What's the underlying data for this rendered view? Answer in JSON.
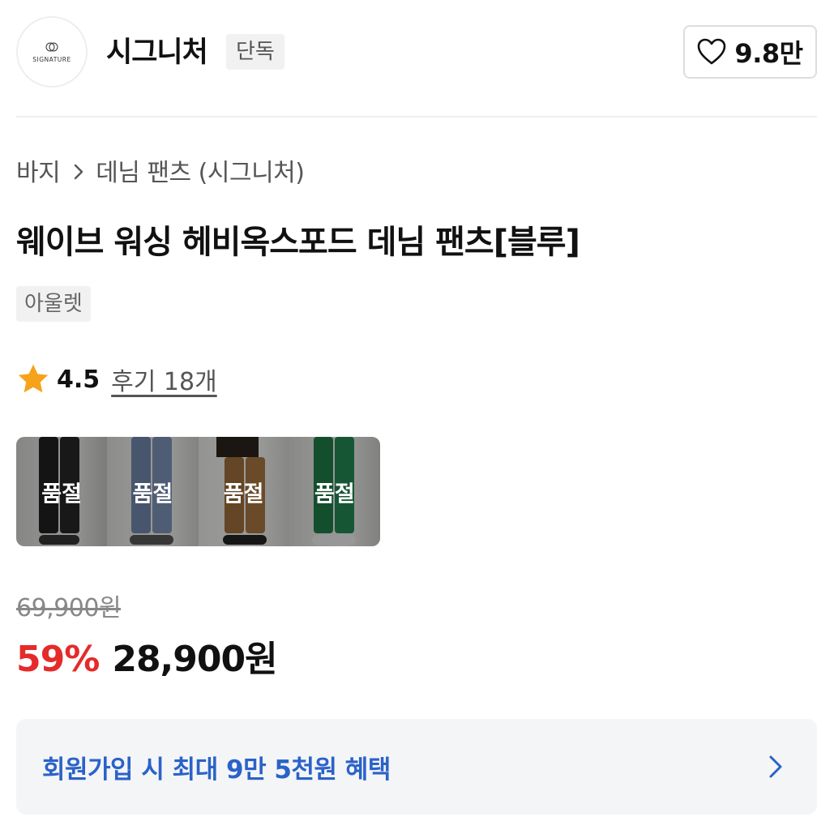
{
  "header": {
    "logo_text": "SIGNATURE",
    "brand_name": "시그니처",
    "exclusive_badge": "단독",
    "like_count": "9.8만"
  },
  "breadcrumb": {
    "items": [
      "바지",
      "데님 팬츠 (시그니처)"
    ],
    "separator_icon": "chevron-right-icon"
  },
  "product": {
    "title": "웨이브 워싱 헤비옥스포드 데님 팬츠[블루]",
    "tag": "아울렛",
    "rating": "4.5",
    "review_link": "후기 18개"
  },
  "colors": [
    {
      "name": "black",
      "status": "품절",
      "pants_color": "#1f1f1f"
    },
    {
      "name": "blue",
      "status": "품절",
      "pants_color": "#6f84a8"
    },
    {
      "name": "brown",
      "status": "품절",
      "pants_color": "#9a6a3a"
    },
    {
      "name": "green",
      "status": "품절",
      "pants_color": "#1f7a45"
    }
  ],
  "price": {
    "original": "69,900원",
    "discount_rate": "59%",
    "sale": "28,900원"
  },
  "banner": {
    "text": "회원가입 시 최대 9만 5천원 혜택",
    "arrow_icon": "chevron-right-icon"
  },
  "theme": {
    "discount_color": "#e52a2a",
    "link_color": "#2a62c9",
    "star_color": "#f7a21b"
  }
}
